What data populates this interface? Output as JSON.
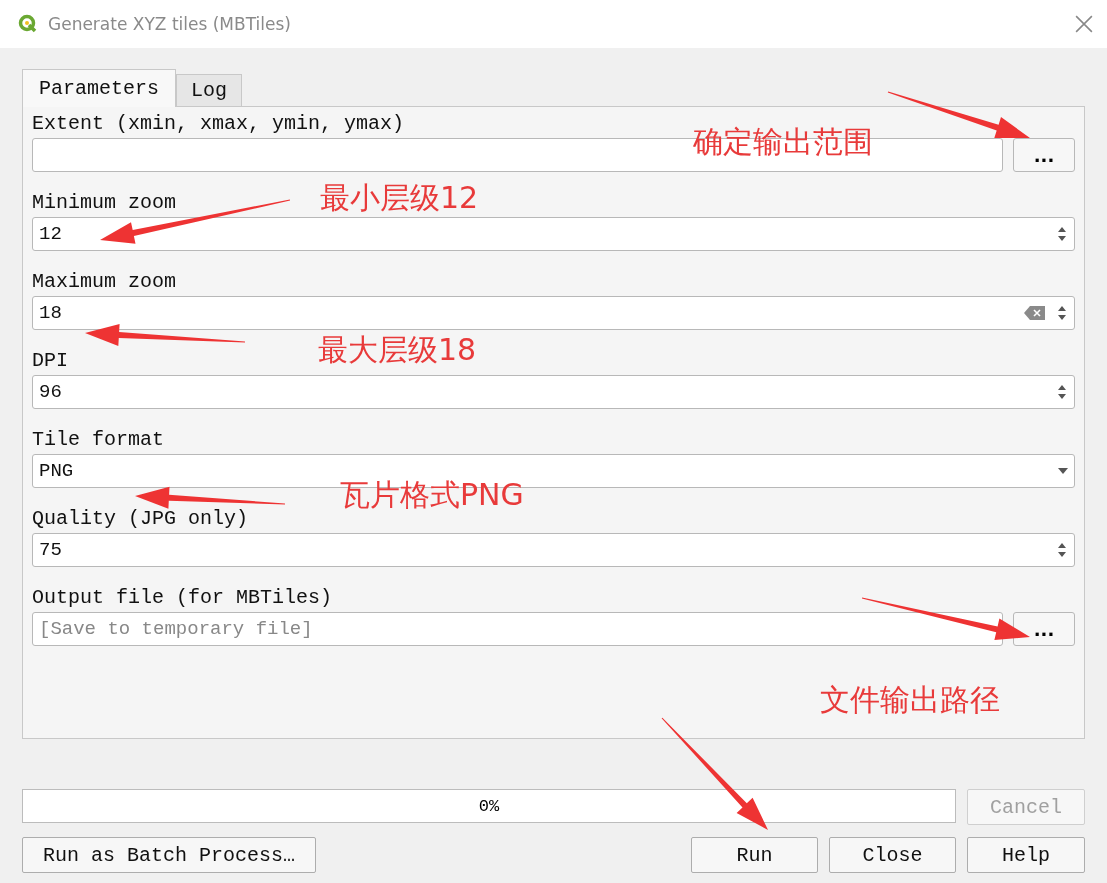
{
  "window": {
    "title": "Generate XYZ tiles (MBTiles)"
  },
  "tabs": [
    {
      "label": "Parameters",
      "selected": true
    },
    {
      "label": "Log",
      "selected": false
    }
  ],
  "parameters": [
    {
      "label": "Extent (xmin, xmax, ymin, ymax)",
      "kind": "browse",
      "browse": "..."
    },
    {
      "label": "Minimum zoom",
      "kind": "spin",
      "value": "12",
      "clearable": false
    },
    {
      "label": "Maximum zoom",
      "kind": "spin",
      "value": "18",
      "clearable": true
    },
    {
      "label": "DPI",
      "kind": "spin",
      "value": "96",
      "clearable": false
    },
    {
      "label": "Tile format",
      "kind": "combo",
      "value": "PNG"
    },
    {
      "label": "Quality (JPG only)",
      "kind": "spin",
      "value": "75",
      "clearable": false
    },
    {
      "label": "Output file (for MBTiles)",
      "kind": "browse",
      "placeholder": "[Save to temporary file]",
      "browse": "..."
    }
  ],
  "annotations": [
    {
      "text": "确定输出范围"
    },
    {
      "text": "最小层级12"
    },
    {
      "text": "最大层级18"
    },
    {
      "text": "瓦片格式PNG"
    },
    {
      "text": "文件输出路径"
    }
  ],
  "progress": {
    "level": 0,
    "text": "0%"
  },
  "cancel_button": {
    "label": "Cancel",
    "disabled": true
  },
  "buttons": [
    {
      "label": "Run as Batch Process…",
      "disabled": false
    },
    {
      "label": "Run",
      "disabled": false
    },
    {
      "label": "Close",
      "disabled": false
    },
    {
      "label": "Help",
      "disabled": false
    }
  ]
}
